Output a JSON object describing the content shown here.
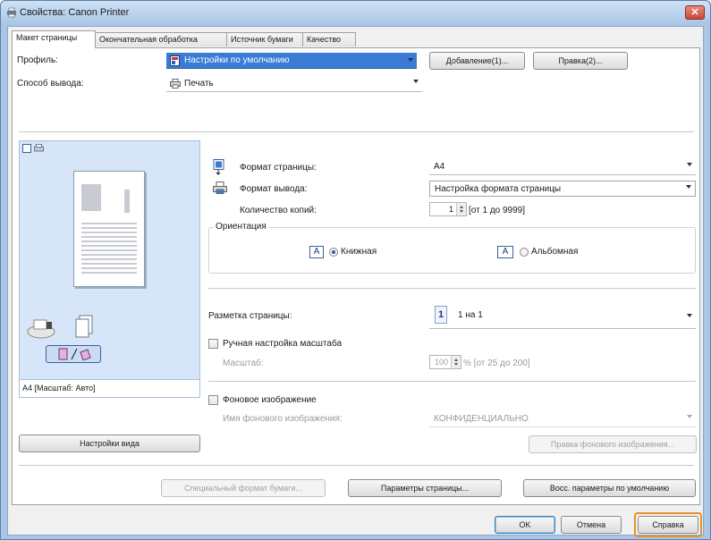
{
  "window": {
    "title": "Свойства: Canon Printer",
    "close_glyph": "✕"
  },
  "tabs": [
    "Макет страницы",
    "Окончательная обработка",
    "Источник бумаги",
    "Качество"
  ],
  "profile": {
    "label": "Профиль:",
    "value": "Настройки по умолчанию",
    "add_button": "Добавление(1)...",
    "edit_button": "Правка(2)..."
  },
  "output": {
    "label": "Способ вывода:",
    "value": "Печать"
  },
  "preview": {
    "caption": "А4 [Масштаб: Авто]",
    "view_settings_button": "Настройки вида"
  },
  "page_size": {
    "label": "Формат страницы:",
    "value": "A4"
  },
  "output_size": {
    "label": "Формат вывода:",
    "value": "Настройка формата страницы"
  },
  "copies": {
    "label": "Количество копий:",
    "value": "1",
    "range": "[от 1 до 9999]"
  },
  "orientation": {
    "title": "Ориентация",
    "portrait": "Книжная",
    "landscape": "Альбомная",
    "selected": "portrait"
  },
  "layout": {
    "label": "Разметка страницы:",
    "value": "1 на 1",
    "icon_digit": "1"
  },
  "manual_scaling": {
    "label": "Ручная настройка масштаба",
    "checked": false
  },
  "scale": {
    "label": "Масштаб:",
    "value": "100",
    "range": "% [от 25 до 200]"
  },
  "watermark": {
    "label": "Фоновое изображение",
    "checked": false,
    "name_label": "Имя фонового изображения:",
    "name_value": "КОНФИДЕНЦИАЛЬНО",
    "edit_button": "Правка фонового изображения..."
  },
  "bottom_buttons": {
    "custom_paper": "Специальный формат бумаги...",
    "page_options": "Параметры страницы...",
    "restore_defaults": "Восс. параметры по умолчанию"
  },
  "dialog_buttons": {
    "ok": "OK",
    "cancel": "Отмена",
    "help": "Справка"
  },
  "colors": {
    "accent_blue": "#3a7bd5",
    "highlight_orange": "#e8902a",
    "preview_bg": "#d6e5f7"
  }
}
